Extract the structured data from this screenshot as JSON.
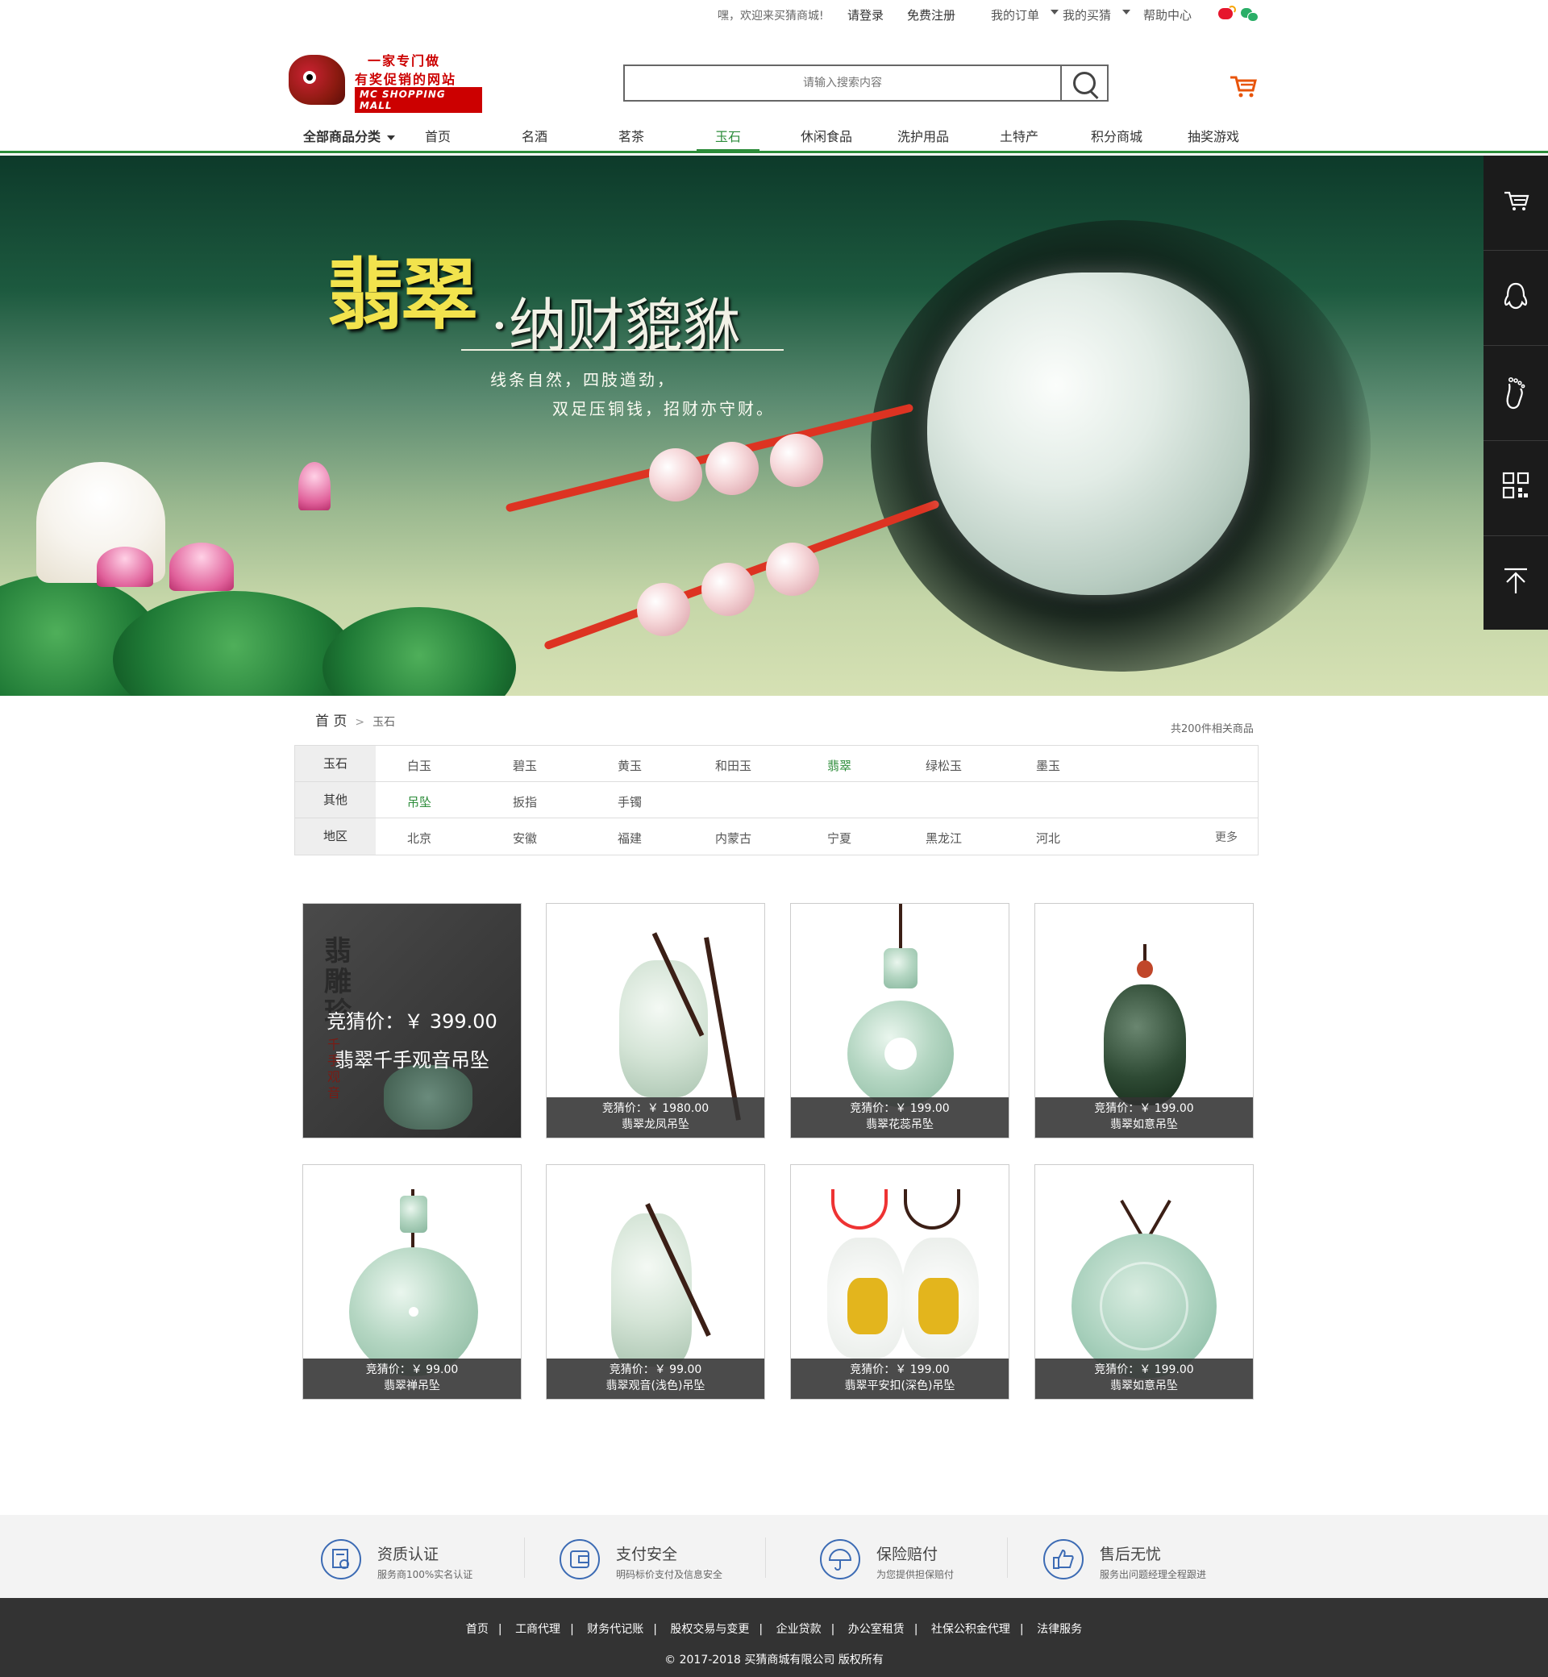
{
  "topbar": {
    "welcome": "嘿，欢迎来买猜商城!",
    "login": "请登录",
    "register": "免费注册",
    "orders": "我的订单",
    "mybid": "我的买猜",
    "help": "帮助中心"
  },
  "logo": {
    "line1": "一家专门做",
    "line2": "有奖促销的网站",
    "line3": "MC SHOPPING MALL"
  },
  "search": {
    "placeholder": "请输入搜索内容"
  },
  "nav": {
    "all": "全部商品分类",
    "items": [
      "首页",
      "名酒",
      "茗茶",
      "玉石",
      "休闲食品",
      "洗护用品",
      "土特产",
      "积分商城",
      "抽奖游戏"
    ],
    "active": "玉石"
  },
  "banner": {
    "title_big": "翡翠",
    "title_rest": "·纳财貔貅",
    "sub1": "线条自然，四肢遒劲，",
    "sub2": "双足压铜钱，招财亦守财。"
  },
  "breadcrumb": {
    "home": "首 页",
    "sep": ">",
    "current": "玉石"
  },
  "total": "共200件相关商品",
  "filter": {
    "rows": [
      {
        "label": "玉石",
        "options": [
          "白玉",
          "碧玉",
          "黄玉",
          "和田玉",
          "翡翠",
          "绿松玉",
          "墨玉"
        ],
        "active": "翡翠"
      },
      {
        "label": "其他",
        "options": [
          "吊坠",
          "扳指",
          "手镯"
        ],
        "active": "吊坠"
      },
      {
        "label": "地区",
        "options": [
          "北京",
          "安徽",
          "福建",
          "内蒙古",
          "宁夏",
          "黑龙江",
          "河北"
        ],
        "more": "更多"
      }
    ]
  },
  "products": [
    {
      "price": "竞猜价：￥  399.00",
      "name": "翡翠千手观音吊坠",
      "feature": true
    },
    {
      "price": "竞猜价：￥  1980.00",
      "name": "翡翠龙凤吊坠"
    },
    {
      "price": "竞猜价：￥  199.00",
      "name": "翡翠花蕊吊坠"
    },
    {
      "price": "竞猜价：￥  199.00",
      "name": "翡翠如意吊坠"
    },
    {
      "price": "竞猜价：￥  99.00",
      "name": "翡翠禅吊坠"
    },
    {
      "price": "竞猜价：￥  99.00",
      "name": "翡翠观音(浅色)吊坠"
    },
    {
      "price": "竞猜价：￥  199.00",
      "name": "翡翠平安扣(深色)吊坠"
    },
    {
      "price": "竞猜价：￥  199.00",
      "name": "翡翠如意吊坠"
    }
  ],
  "feature_art": {
    "text": "翡雕珍",
    "sub": "千手观音"
  },
  "promises": [
    {
      "title": "资质认证",
      "desc": "服务商100%实名认证",
      "icon": "certificate-icon"
    },
    {
      "title": "支付安全",
      "desc": "明码标价支付及信息安全",
      "icon": "wallet-icon"
    },
    {
      "title": "保险赔付",
      "desc": "为您提供担保赔付",
      "icon": "umbrella-icon"
    },
    {
      "title": "售后无忧",
      "desc": "服务出问题经理全程跟进",
      "icon": "thumbs-up-icon"
    }
  ],
  "footer": {
    "links": [
      "首页",
      "工商代理",
      "财务代记账",
      "股权交易与变更",
      "企业贷款",
      "办公室租赁",
      "社保公积金代理",
      "法律服务"
    ],
    "sep": "|",
    "copyright": "© 2017-2018  买猜商城有限公司 版权所有"
  },
  "colors": {
    "accent": "#2c8c3a",
    "footer_bg": "#333333",
    "sidebar_bg": "#1b1b1b",
    "brand_red": "#cc0000"
  }
}
